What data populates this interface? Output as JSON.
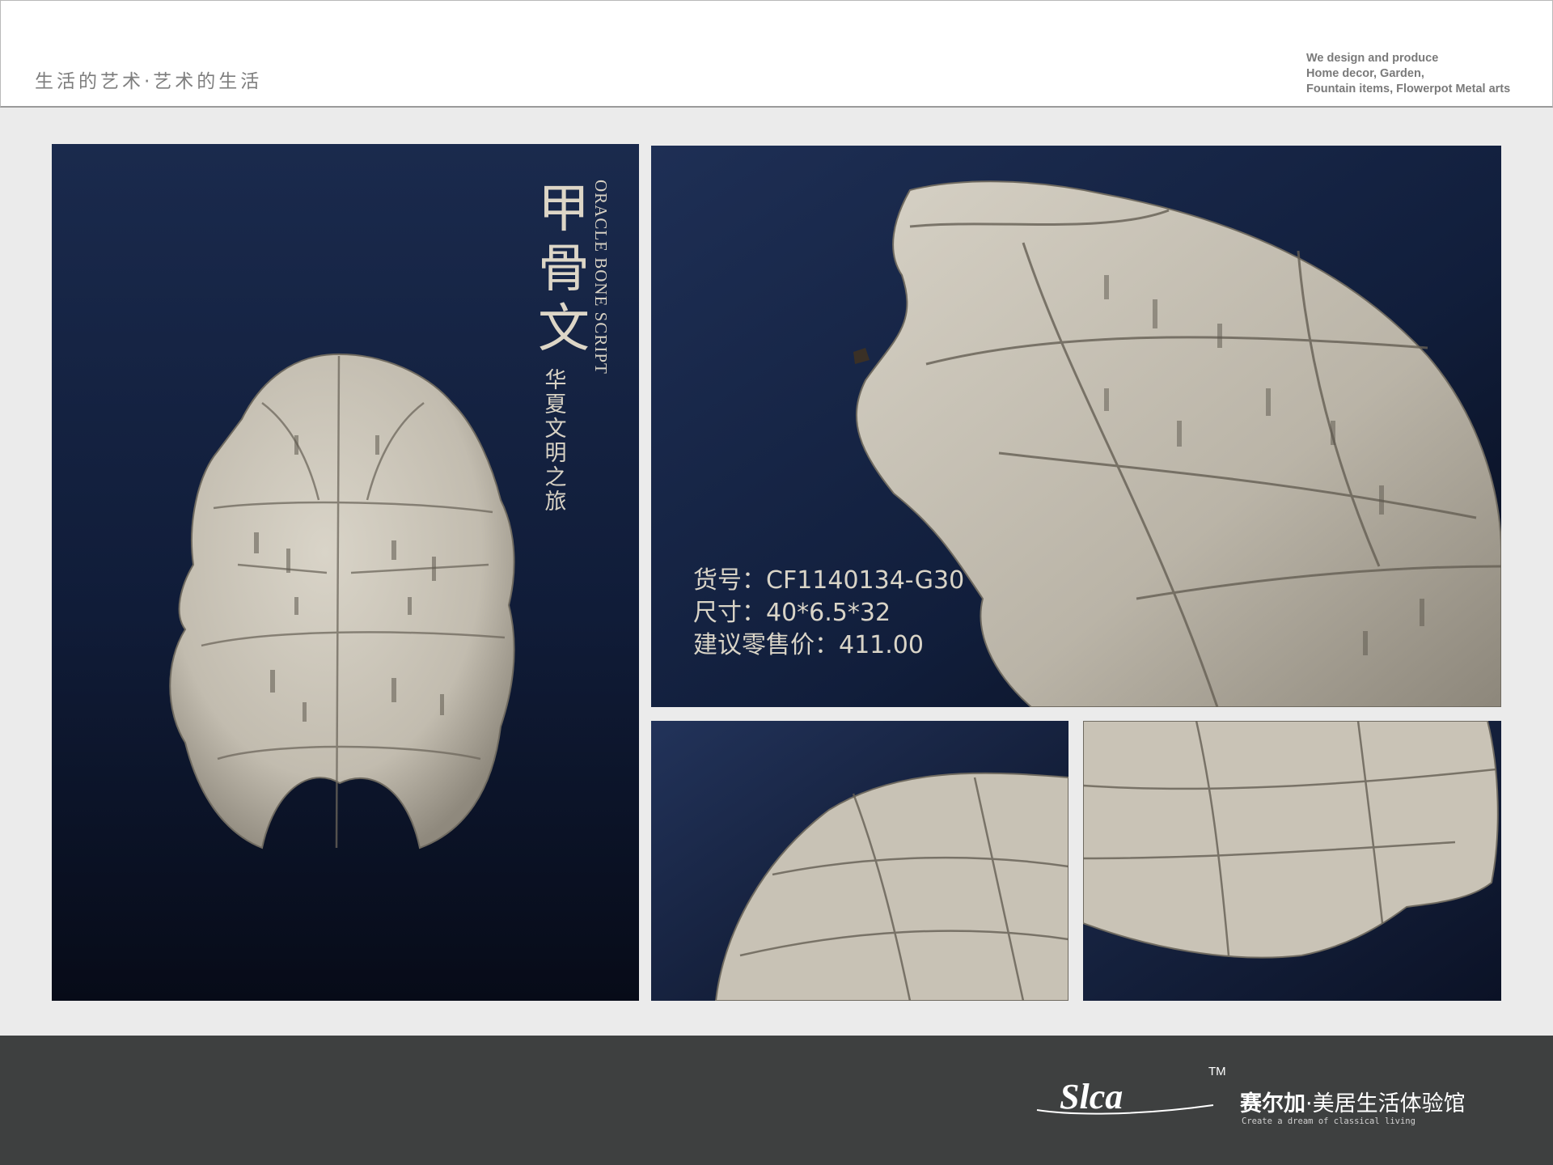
{
  "header": {
    "tagline": "生活的艺术·艺术的生活",
    "company_blurb": [
      "We design and produce",
      "Home decor, Garden,",
      "Fountain items, Flowerpot Metal arts"
    ]
  },
  "main_panel": {
    "title_cn": "甲骨文",
    "title_en": "ORACLE BONE SCRIPT",
    "subtitle_cn": "华夏文明之旅"
  },
  "product": {
    "item_no": "货号：CF1140134-G30",
    "size": "尺寸：40*6.5*32",
    "price": "建议零售价：411.00"
  },
  "footer": {
    "logo_text": "Slca",
    "tm": "TM",
    "brand_bold": "赛尔加",
    "brand_rest": "·美居生活体验馆",
    "slogan": "Create a dream of classical living"
  },
  "colors": {
    "background": "#ebebeb",
    "panel_dark": "#0e1a33",
    "shell": "#cfc9bd",
    "footer": "#3e4040"
  }
}
